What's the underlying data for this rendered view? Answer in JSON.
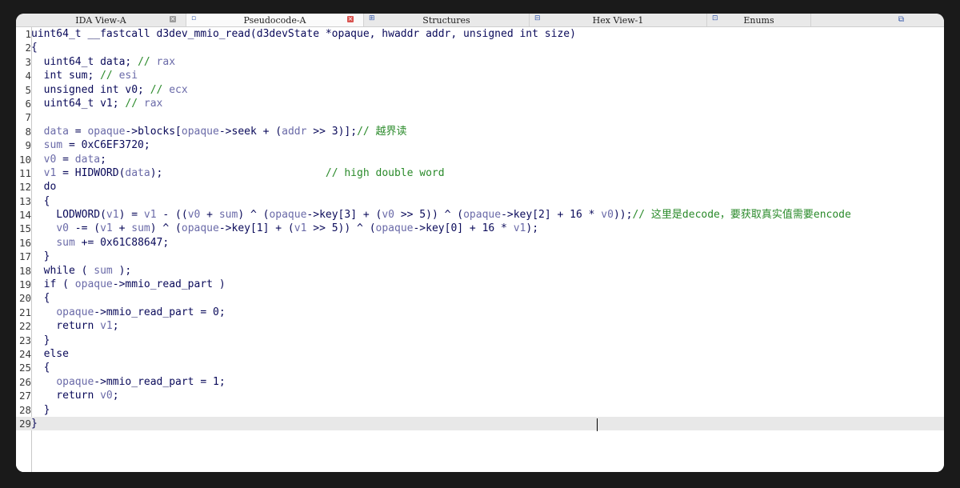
{
  "tabs": [
    {
      "label": "IDA View-A",
      "icon": "ida-view-icon",
      "active": false,
      "closable": true
    },
    {
      "label": "Pseudocode-A",
      "icon": "pseudocode-icon",
      "active": true,
      "closable": true
    },
    {
      "label": "Structures",
      "icon": "structures-icon",
      "active": false,
      "closable": false
    },
    {
      "label": "Hex View-1",
      "icon": "hex-view-icon",
      "active": false,
      "closable": false
    },
    {
      "label": "Enums",
      "icon": "enums-icon",
      "active": false,
      "closable": false
    }
  ],
  "code_lines": [
    {
      "n": "1",
      "t": [
        [
          "kw",
          "uint64_t __fastcall d3dev_mmio_read(d3devState *opaque, hwaddr addr, unsigned int size)"
        ]
      ]
    },
    {
      "n": "2",
      "t": [
        [
          "kw",
          "{"
        ]
      ]
    },
    {
      "n": "3",
      "t": [
        [
          "kw",
          "  uint64_t data; "
        ],
        [
          "cm",
          "// "
        ],
        [
          "var",
          "rax"
        ]
      ]
    },
    {
      "n": "4",
      "t": [
        [
          "kw",
          "  int sum; "
        ],
        [
          "cm",
          "// "
        ],
        [
          "var",
          "esi"
        ]
      ]
    },
    {
      "n": "5",
      "t": [
        [
          "kw",
          "  unsigned int v0; "
        ],
        [
          "cm",
          "// "
        ],
        [
          "var",
          "ecx"
        ]
      ]
    },
    {
      "n": "6",
      "t": [
        [
          "kw",
          "  uint64_t v1; "
        ],
        [
          "cm",
          "// "
        ],
        [
          "var",
          "rax"
        ]
      ]
    },
    {
      "n": "7",
      "t": []
    },
    {
      "n": "8",
      "t": [
        [
          "kw",
          "  "
        ],
        [
          "var",
          "data"
        ],
        [
          "kw",
          " = "
        ],
        [
          "var",
          "opaque"
        ],
        [
          "kw",
          "->blocks["
        ],
        [
          "var",
          "opaque"
        ],
        [
          "kw",
          "->seek + ("
        ],
        [
          "var",
          "addr"
        ],
        [
          "kw",
          " >> 3)];"
        ],
        [
          "cm",
          "// 越界读"
        ]
      ]
    },
    {
      "n": "9",
      "t": [
        [
          "kw",
          "  "
        ],
        [
          "var",
          "sum"
        ],
        [
          "kw",
          " = 0xC6EF3720;"
        ]
      ]
    },
    {
      "n": "10",
      "t": [
        [
          "kw",
          "  "
        ],
        [
          "var",
          "v0"
        ],
        [
          "kw",
          " = "
        ],
        [
          "var",
          "data"
        ],
        [
          "kw",
          ";"
        ]
      ]
    },
    {
      "n": "11",
      "t": [
        [
          "kw",
          "  "
        ],
        [
          "var",
          "v1"
        ],
        [
          "kw",
          " = HIDWORD("
        ],
        [
          "var",
          "data"
        ],
        [
          "kw",
          ");                          "
        ],
        [
          "cm",
          "// high double word"
        ]
      ]
    },
    {
      "n": "12",
      "t": [
        [
          "kw",
          "  do"
        ]
      ]
    },
    {
      "n": "13",
      "t": [
        [
          "kw",
          "  {"
        ]
      ]
    },
    {
      "n": "14",
      "t": [
        [
          "kw",
          "    LODWORD("
        ],
        [
          "var",
          "v1"
        ],
        [
          "kw",
          ") = "
        ],
        [
          "var",
          "v1"
        ],
        [
          "kw",
          " - (("
        ],
        [
          "var",
          "v0"
        ],
        [
          "kw",
          " + "
        ],
        [
          "var",
          "sum"
        ],
        [
          "kw",
          ") ^ ("
        ],
        [
          "var",
          "opaque"
        ],
        [
          "kw",
          "->key[3] + ("
        ],
        [
          "var",
          "v0"
        ],
        [
          "kw",
          " >> 5)) ^ ("
        ],
        [
          "var",
          "opaque"
        ],
        [
          "kw",
          "->key[2] + 16 * "
        ],
        [
          "var",
          "v0"
        ],
        [
          "kw",
          "));"
        ],
        [
          "cm",
          "// 这里是decode，要获取真实值需要encode"
        ]
      ]
    },
    {
      "n": "15",
      "t": [
        [
          "kw",
          "    "
        ],
        [
          "var",
          "v0"
        ],
        [
          "kw",
          " -= ("
        ],
        [
          "var",
          "v1"
        ],
        [
          "kw",
          " + "
        ],
        [
          "var",
          "sum"
        ],
        [
          "kw",
          ") ^ ("
        ],
        [
          "var",
          "opaque"
        ],
        [
          "kw",
          "->key[1] + ("
        ],
        [
          "var",
          "v1"
        ],
        [
          "kw",
          " >> 5)) ^ ("
        ],
        [
          "var",
          "opaque"
        ],
        [
          "kw",
          "->key[0] + 16 * "
        ],
        [
          "var",
          "v1"
        ],
        [
          "kw",
          ");"
        ]
      ]
    },
    {
      "n": "16",
      "t": [
        [
          "kw",
          "    "
        ],
        [
          "var",
          "sum"
        ],
        [
          "kw",
          " += 0x61C88647;"
        ]
      ]
    },
    {
      "n": "17",
      "t": [
        [
          "kw",
          "  }"
        ]
      ]
    },
    {
      "n": "18",
      "t": [
        [
          "kw",
          "  while ( "
        ],
        [
          "var",
          "sum"
        ],
        [
          "kw",
          " );"
        ]
      ]
    },
    {
      "n": "19",
      "t": [
        [
          "kw",
          "  if ( "
        ],
        [
          "var",
          "opaque"
        ],
        [
          "kw",
          "->mmio_read_part )"
        ]
      ]
    },
    {
      "n": "20",
      "t": [
        [
          "kw",
          "  {"
        ]
      ]
    },
    {
      "n": "21",
      "t": [
        [
          "kw",
          "    "
        ],
        [
          "var",
          "opaque"
        ],
        [
          "kw",
          "->mmio_read_part = 0;"
        ]
      ]
    },
    {
      "n": "22",
      "t": [
        [
          "kw",
          "    return "
        ],
        [
          "var",
          "v1"
        ],
        [
          "kw",
          ";"
        ]
      ]
    },
    {
      "n": "23",
      "t": [
        [
          "kw",
          "  }"
        ]
      ]
    },
    {
      "n": "24",
      "t": [
        [
          "kw",
          "  else"
        ]
      ]
    },
    {
      "n": "25",
      "t": [
        [
          "kw",
          "  {"
        ]
      ]
    },
    {
      "n": "26",
      "t": [
        [
          "kw",
          "    "
        ],
        [
          "var",
          "opaque"
        ],
        [
          "kw",
          "->mmio_read_part = 1;"
        ]
      ]
    },
    {
      "n": "27",
      "t": [
        [
          "kw",
          "    return "
        ],
        [
          "var",
          "v0"
        ],
        [
          "kw",
          ";"
        ]
      ]
    },
    {
      "n": "28",
      "t": [
        [
          "kw",
          "  }"
        ]
      ]
    },
    {
      "n": "29",
      "t": [
        [
          "kw",
          "}"
        ]
      ]
    }
  ],
  "current_line": "29",
  "colors": {
    "keyword": "#0a0a5a",
    "variable": "#6a6aa8",
    "comment": "#2a8a2a",
    "active_close": "#d9534f"
  }
}
